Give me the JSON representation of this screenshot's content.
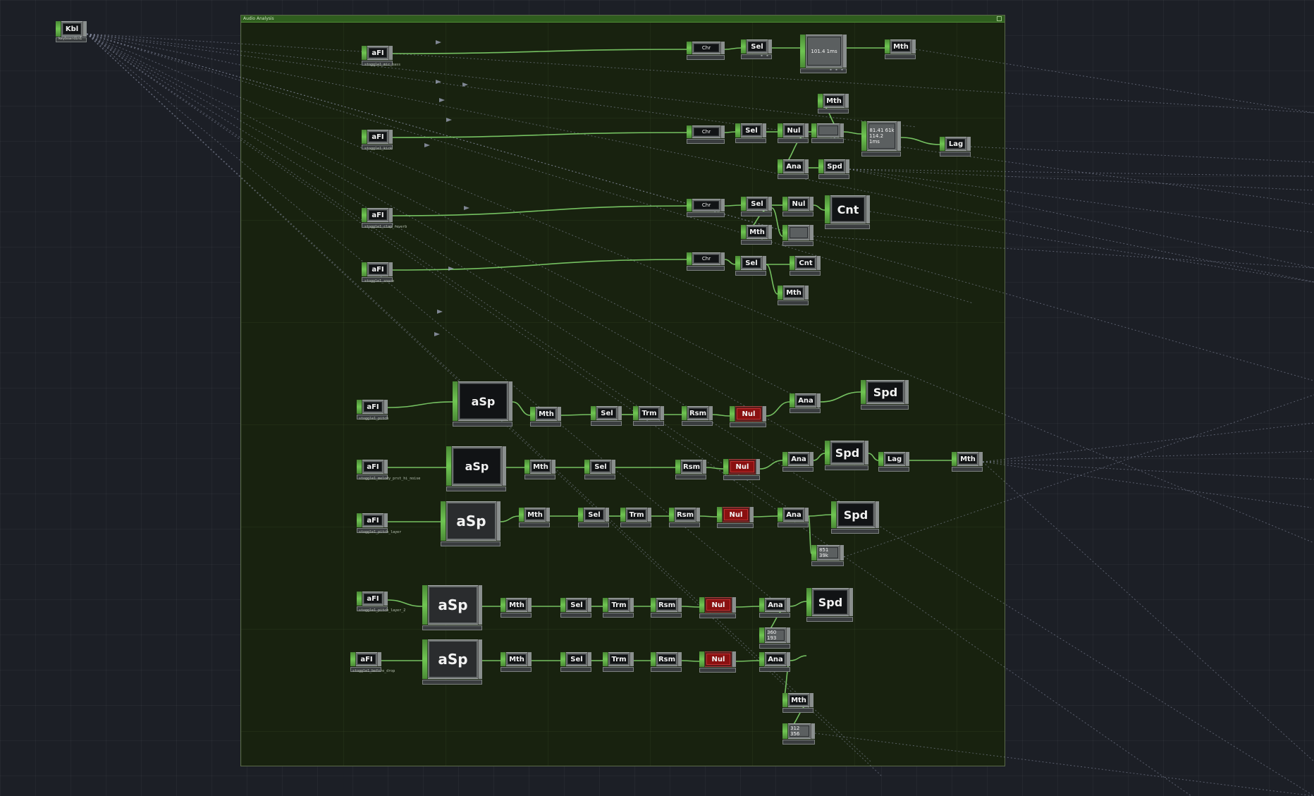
{
  "container": {
    "title": "Audio Analysis"
  },
  "nodes": {
    "kbd": {
      "face": "Kbl",
      "label": "keyboardin1"
    },
    "afi1": {
      "face": "aFI",
      "label": "stoggle1_mic_bass"
    },
    "afi2": {
      "face": "aFI",
      "label": "stoggle1_kick"
    },
    "afi3": {
      "face": "aFI",
      "label": "stoggle1_clap_reverb"
    },
    "afi4": {
      "face": "aFI",
      "label": "stoggle1_snare"
    },
    "afi5": {
      "face": "aFI",
      "label": "stoggle1_pitch"
    },
    "afi6": {
      "face": "aFI",
      "label": "stoggle1_melody_prst_hi_noise"
    },
    "afi7": {
      "face": "aFI",
      "label": "stoggle1_pitch_layer"
    },
    "afi8": {
      "face": "aFI",
      "label": "stoggle1_pitch_layer_2"
    },
    "afi9": {
      "face": "aFI",
      "label": "stoggle1_before_drop"
    },
    "chop": {
      "face": "Chr"
    },
    "sel": {
      "face": "Sel"
    },
    "mth": {
      "face": "Mth"
    },
    "nul": {
      "face": "Nul"
    },
    "ana": {
      "face": "Ana"
    },
    "spd": {
      "face": "Spd"
    },
    "cnt": {
      "face": "Cnt"
    },
    "lag": {
      "face": "Lag"
    },
    "trm": {
      "face": "Trm"
    },
    "rsm": {
      "face": "Rsm"
    },
    "asp": {
      "face": "aSp"
    },
    "trail1": {
      "value": "101.4 1ms"
    },
    "trail2": {
      "value": "81.41 61k"
    },
    "trail2b": {
      "value": "114.2 1ms"
    },
    "trail3": {
      "value": "851 39k"
    },
    "trail4": {
      "value": "360 193"
    },
    "trail5": {
      "value": "312 356"
    }
  }
}
